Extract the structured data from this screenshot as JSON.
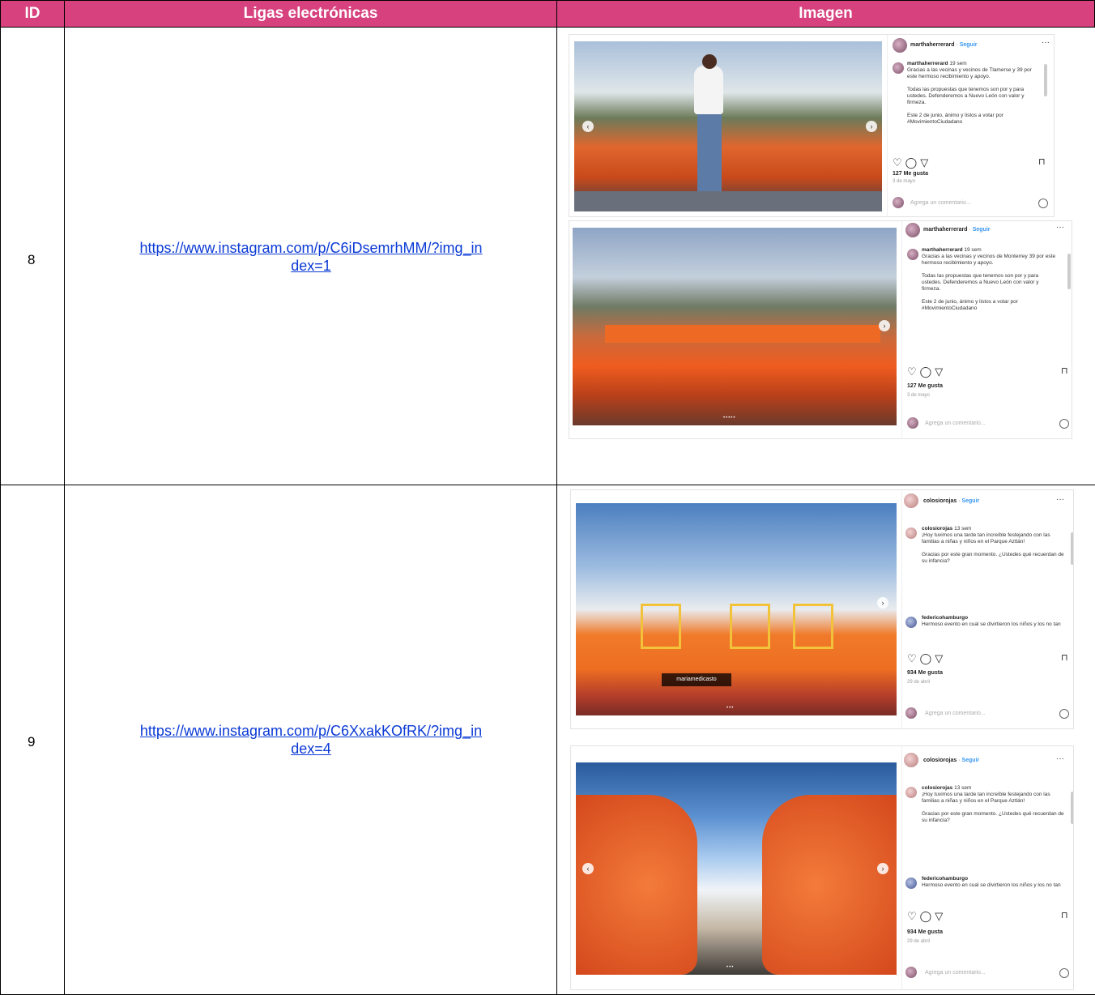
{
  "header": {
    "id": "ID",
    "links": "Ligas electrónicas",
    "image": "Imagen"
  },
  "rows": [
    {
      "id": "8",
      "link_line1": "https://www.instagram.com/p/C6iDsemrhMM/?img_in",
      "link_line2": "dex=1",
      "posts": [
        {
          "user": "marthaherrerard",
          "follow": "Seguir",
          "time": "19 sem",
          "caption1": "Gracias a las vecinas y vecinos de Tlamerse y 39 por este hermoso recibimiento y apoyo.",
          "caption2": "Todas las propuestas que tenemos son por y para ustedes. Defenderemos a Nuevo León con valor y firmeza.",
          "caption3": "Este 2 de junio, ánimo y listos a votar por #MovimientoCiudadano",
          "likes": "127 Me gusta",
          "date": "3 de mayo",
          "comment": "Agrega un comentario..."
        },
        {
          "user": "marthaherrerard",
          "follow": "Seguir",
          "time": "19 sem",
          "caption1": "Gracias a las vecinas y vecinos de Monterrey 39 por este hermoso recibimiento y apoyo.",
          "caption2": "Todas las propuestas que tenemos son por y para ustedes. Defenderemos a Nuevo León con valor y firmeza.",
          "caption3": "Este 2 de junio, ánimo y listos a votar por #MovimientoCiudadano",
          "likes": "127 Me gusta",
          "date": "3 de mayo",
          "comment": "Agrega un comentario..."
        }
      ]
    },
    {
      "id": "9",
      "link_line1": "https://www.instagram.com/p/C6XxakKOfRK/?img_in",
      "link_line2": "dex=4",
      "posts": [
        {
          "user": "colosiorojas",
          "follow": "Seguir",
          "time": "13 sem",
          "caption1": "¡Hoy tuvimos una tarde tan increíble festejando con las familias a niñas y niños en el Parque Aztlán!",
          "caption2": "Gracias por este gran momento. ¿Ustedes qué recuerdan de su infancia?",
          "commenter": "federicohamburgo",
          "comment_text": "Hermoso evento en cual se divirtieron los niños y los no tan",
          "likes": "934 Me gusta",
          "date": "29 de abril",
          "comment": "Agrega un comentario...",
          "tag": "mariamedicasto"
        },
        {
          "user": "colosiorojas",
          "follow": "Seguir",
          "time": "13 sem",
          "caption1": "¡Hoy tuvimos una tarde tan increíble festejando con las familias a niñas y niños en el Parque Aztlán!",
          "caption2": "Gracias por este gran momento. ¿Ustedes qué recuerdan de su infancia?",
          "commenter": "federicohamburgo",
          "comment_text": "Hermoso evento en cual se divirtieron los niños y los no tan",
          "likes": "934 Me gusta",
          "date": "29 de abril",
          "comment": "Agrega un comentario..."
        }
      ]
    }
  ]
}
